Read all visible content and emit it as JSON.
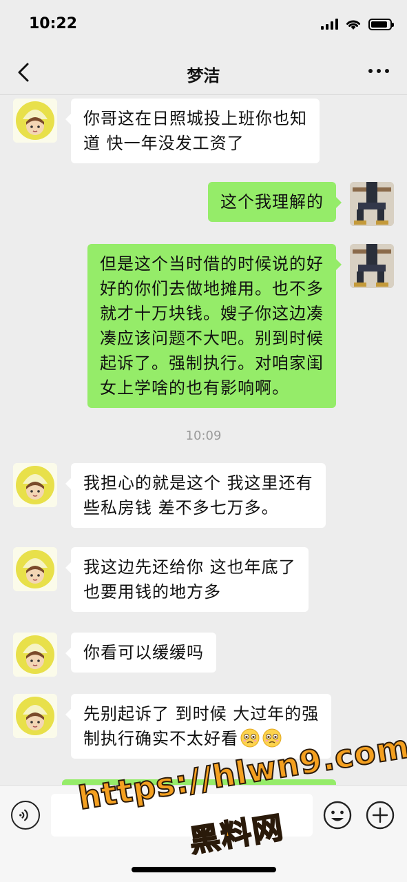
{
  "status_bar": {
    "time": "10:22",
    "battery_level": 0.9
  },
  "nav": {
    "title": "梦洁",
    "back_icon": "chevron-left-icon",
    "more_icon": "more-dots-icon"
  },
  "messages": [
    {
      "side": "left",
      "text": "你哥这在日照城投上班你也知\n道 快一年没发工资了"
    },
    {
      "side": "right",
      "text": "这个我理解的"
    },
    {
      "side": "right",
      "text": "但是这个当时借的时候说的好\n好的你们去做地摊用。也不多\n就才十万块钱。嫂子你这边凑\n凑应该问题不大吧。别到时候\n起诉了。强制执行。对咱家闺\n女上学啥的也有影响啊。"
    },
    {
      "side": "left",
      "text": "我担心的就是这个 我这里还有\n些私房钱 差不多七万多。"
    },
    {
      "side": "left",
      "text": "我这边先还给你 这也年底了\n也要用钱的地方多"
    },
    {
      "side": "left",
      "text": "你看可以缓缓吗"
    },
    {
      "side": "left",
      "text": "先别起诉了 到时候 大过年的强\n制执行确实不太好看",
      "emoji": "pleading-face-emoji"
    }
  ],
  "timestamp": "10:09",
  "input_bar": {
    "voice_icon": "voice-icon",
    "emoji_icon": "smile-icon",
    "plus_icon": "plus-icon",
    "input_value": ""
  },
  "watermark": {
    "url": "https://hlwn9.com",
    "name": "黑料网"
  },
  "colors": {
    "background": "#ededed",
    "bubble_self": "#95ec69",
    "bubble_other": "#ffffff",
    "watermark": "#f4a020"
  }
}
